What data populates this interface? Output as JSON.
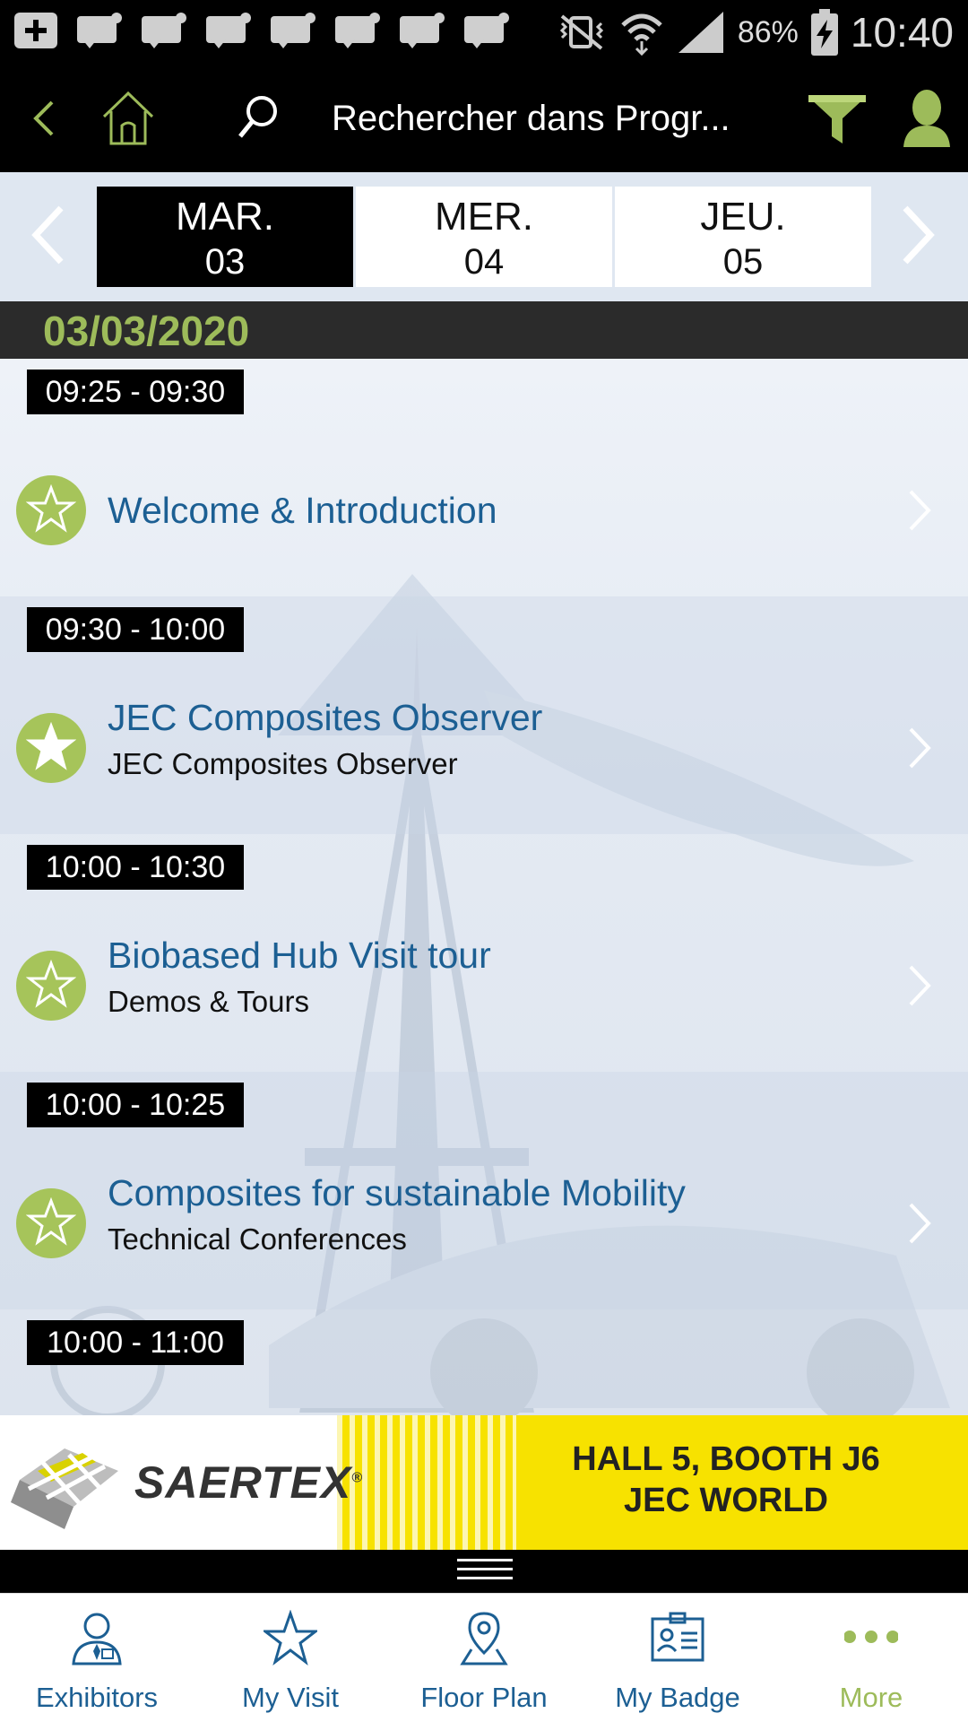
{
  "status_bar": {
    "battery_percent": "86%",
    "time": "10:40"
  },
  "app_bar": {
    "search_title": "Rechercher dans Progr..."
  },
  "days": [
    {
      "name": "MAR.",
      "num": "03",
      "selected": true
    },
    {
      "name": "MER.",
      "num": "04",
      "selected": false
    },
    {
      "name": "JEU.",
      "num": "05",
      "selected": false
    }
  ],
  "date_header": "03/03/2020",
  "sessions": [
    {
      "time": "09:25 - 09:30",
      "title": "Welcome & Introduction",
      "subtitle": "",
      "favorite": false
    },
    {
      "time": "09:30 - 10:00",
      "title": "JEC Composites Observer",
      "subtitle": "JEC Composites Observer",
      "favorite": true
    },
    {
      "time": "10:00 - 10:30",
      "title": "Biobased Hub Visit tour",
      "subtitle": "Demos & Tours",
      "favorite": false
    },
    {
      "time": "10:00 - 10:25",
      "title": "Composites for sustainable Mobility",
      "subtitle": "Technical Conferences",
      "favorite": false
    },
    {
      "time": "10:00 - 11:00",
      "title": "",
      "subtitle": "",
      "favorite": false
    }
  ],
  "banner": {
    "brand": "SAERTEX",
    "line1": "HALL 5, BOOTH J6",
    "line2": "JEC WORLD"
  },
  "bottom_nav": [
    {
      "label": "Exhibitors",
      "icon": "exhibitor-icon"
    },
    {
      "label": "My Visit",
      "icon": "star-icon"
    },
    {
      "label": "Floor Plan",
      "icon": "map-pin-icon"
    },
    {
      "label": "My Badge",
      "icon": "badge-icon"
    },
    {
      "label": "More",
      "icon": "more-dots-icon",
      "active": true
    }
  ],
  "colors": {
    "accent_green": "#9dbb5a",
    "link_blue": "#1c5f93",
    "banner_yellow": "#f7e200"
  }
}
